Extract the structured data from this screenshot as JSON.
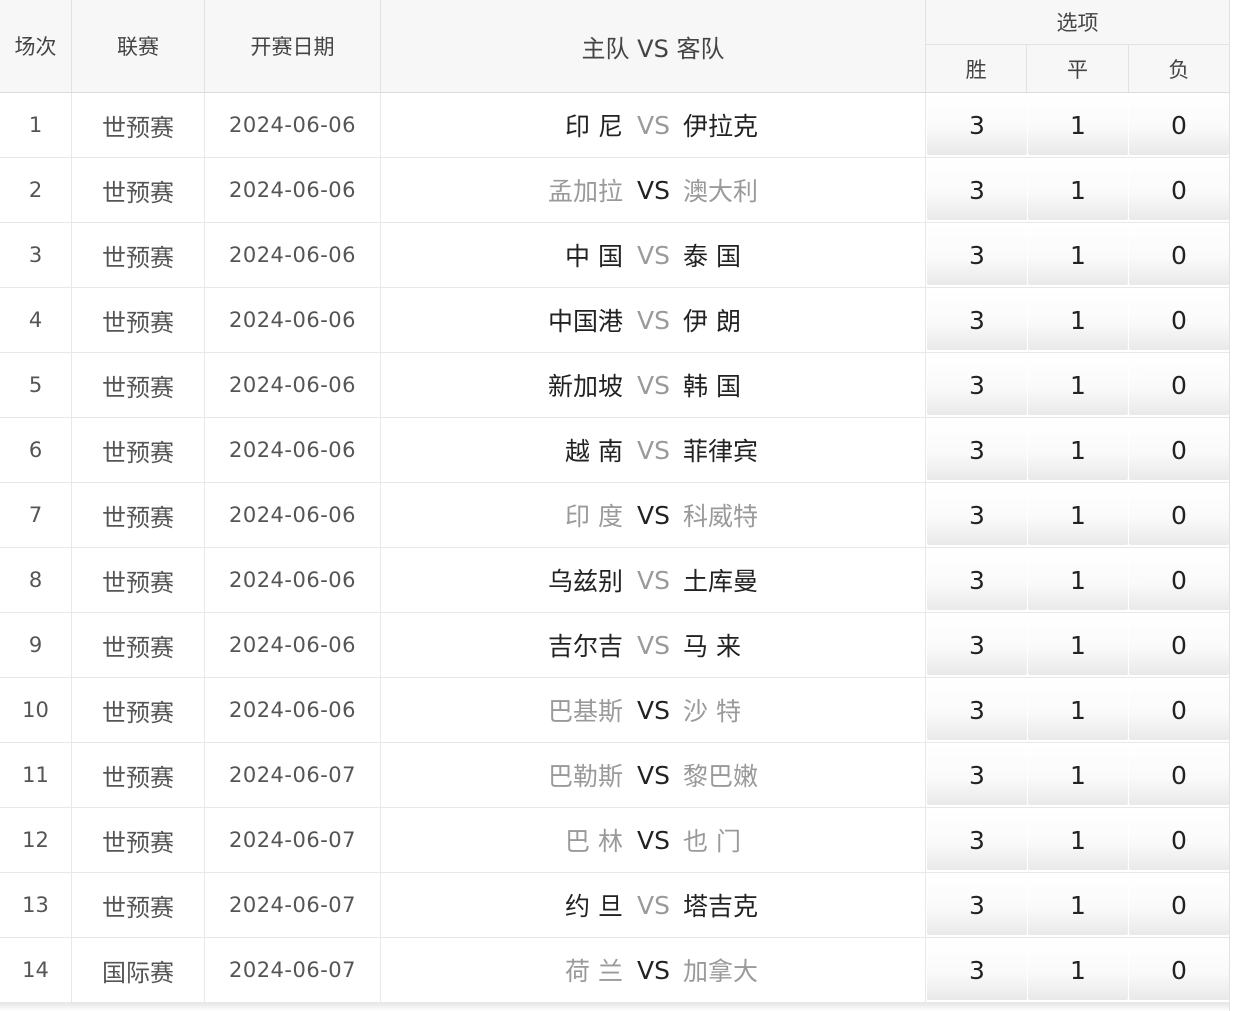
{
  "header": {
    "no": "场次",
    "league": "联赛",
    "date": "开赛日期",
    "match": "主队 VS 客队",
    "options_title": "选项",
    "win": "胜",
    "draw": "平",
    "lose": "负"
  },
  "vs_label": "VS",
  "rows": [
    {
      "no": "1",
      "league": "世预赛",
      "date": "2024-06-06",
      "home": "印 尼",
      "away": "伊拉克",
      "win": "3",
      "draw": "1",
      "lose": "0"
    },
    {
      "no": "2",
      "league": "世预赛",
      "date": "2024-06-06",
      "home": "孟加拉",
      "away": "澳大利",
      "win": "3",
      "draw": "1",
      "lose": "0"
    },
    {
      "no": "3",
      "league": "世预赛",
      "date": "2024-06-06",
      "home": "中 国",
      "away": "泰 国",
      "win": "3",
      "draw": "1",
      "lose": "0"
    },
    {
      "no": "4",
      "league": "世预赛",
      "date": "2024-06-06",
      "home": "中国港",
      "away": "伊 朗",
      "win": "3",
      "draw": "1",
      "lose": "0"
    },
    {
      "no": "5",
      "league": "世预赛",
      "date": "2024-06-06",
      "home": "新加坡",
      "away": "韩 国",
      "win": "3",
      "draw": "1",
      "lose": "0"
    },
    {
      "no": "6",
      "league": "世预赛",
      "date": "2024-06-06",
      "home": "越 南",
      "away": "菲律宾",
      "win": "3",
      "draw": "1",
      "lose": "0"
    },
    {
      "no": "7",
      "league": "世预赛",
      "date": "2024-06-06",
      "home": "印 度",
      "away": "科威特",
      "win": "3",
      "draw": "1",
      "lose": "0"
    },
    {
      "no": "8",
      "league": "世预赛",
      "date": "2024-06-06",
      "home": "乌兹别",
      "away": "土库曼",
      "win": "3",
      "draw": "1",
      "lose": "0"
    },
    {
      "no": "9",
      "league": "世预赛",
      "date": "2024-06-06",
      "home": "吉尔吉",
      "away": "马 来",
      "win": "3",
      "draw": "1",
      "lose": "0"
    },
    {
      "no": "10",
      "league": "世预赛",
      "date": "2024-06-06",
      "home": "巴基斯",
      "away": "沙 特",
      "win": "3",
      "draw": "1",
      "lose": "0"
    },
    {
      "no": "11",
      "league": "世预赛",
      "date": "2024-06-07",
      "home": "巴勒斯",
      "away": "黎巴嫩",
      "win": "3",
      "draw": "1",
      "lose": "0"
    },
    {
      "no": "12",
      "league": "世预赛",
      "date": "2024-06-07",
      "home": "巴 林",
      "away": "也 门",
      "win": "3",
      "draw": "1",
      "lose": "0"
    },
    {
      "no": "13",
      "league": "世预赛",
      "date": "2024-06-07",
      "home": "约 旦",
      "away": "塔吉克",
      "win": "3",
      "draw": "1",
      "lose": "0"
    },
    {
      "no": "14",
      "league": "国际赛",
      "date": "2024-06-07",
      "home": "荷 兰",
      "away": "加拿大",
      "win": "3",
      "draw": "1",
      "lose": "0"
    }
  ]
}
